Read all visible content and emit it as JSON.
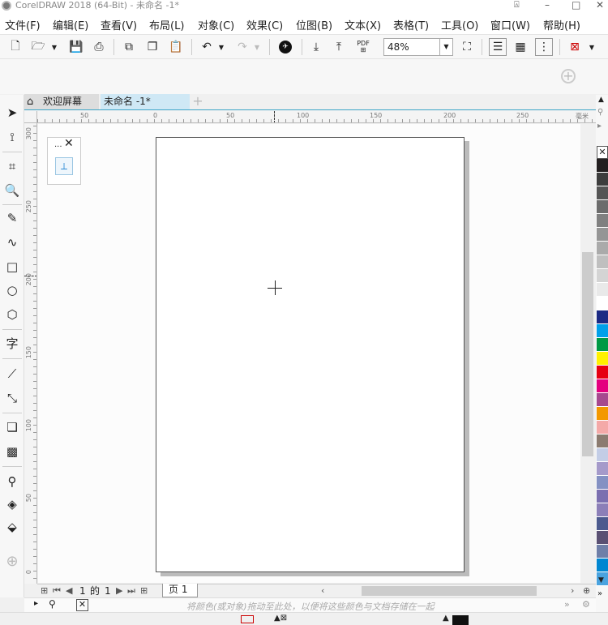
{
  "window": {
    "title": "CorelDRAW 2018 (64-Bit) - 未命名 -1*"
  },
  "menu": [
    "文件(F)",
    "编辑(E)",
    "查看(V)",
    "布局(L)",
    "对象(C)",
    "效果(C)",
    "位图(B)",
    "文本(X)",
    "表格(T)",
    "工具(O)",
    "窗口(W)",
    "帮助(H)"
  ],
  "toolbar": {
    "zoom_value": "48%",
    "pdf_label": "PDF"
  },
  "tabs": {
    "welcome": "欢迎屏幕",
    "document": "未命名 -1*"
  },
  "ruler": {
    "units": "毫米",
    "h_labels": [
      "50",
      "0",
      "50",
      "100",
      "150",
      "200",
      "250"
    ],
    "v_labels": [
      "300",
      "250",
      "200",
      "150",
      "100",
      "50",
      "0"
    ]
  },
  "mini_panel": {
    "dots": "...",
    "close": "✕"
  },
  "pagebar": {
    "current": "1",
    "of_label": "的",
    "total": "1",
    "page_tab": "页 1"
  },
  "docpalette": {
    "hint": "将颜色(或对象)拖动至此处，以便将这些颜色与文档存储在一起"
  },
  "palette": {
    "colors": [
      "#231f20",
      "#3d3d3d",
      "#555555",
      "#6c6c6c",
      "#808080",
      "#959595",
      "#aaaaaa",
      "#bfbfbf",
      "#d4d4d4",
      "#e9e9e9",
      "#ffffff",
      "#1c2a84",
      "#00a0e9",
      "#009944",
      "#fff100",
      "#e60012",
      "#e4007f",
      "#a6498f",
      "#f39800",
      "#f4a9a8",
      "#8b7b70",
      "#c3cde6",
      "#a59aca",
      "#8491c3",
      "#7b6fb0",
      "#8c7fb8",
      "#4c5a8e",
      "#5a5073",
      "#6f7fa8",
      "#0086d1",
      "#4aa3df"
    ]
  }
}
